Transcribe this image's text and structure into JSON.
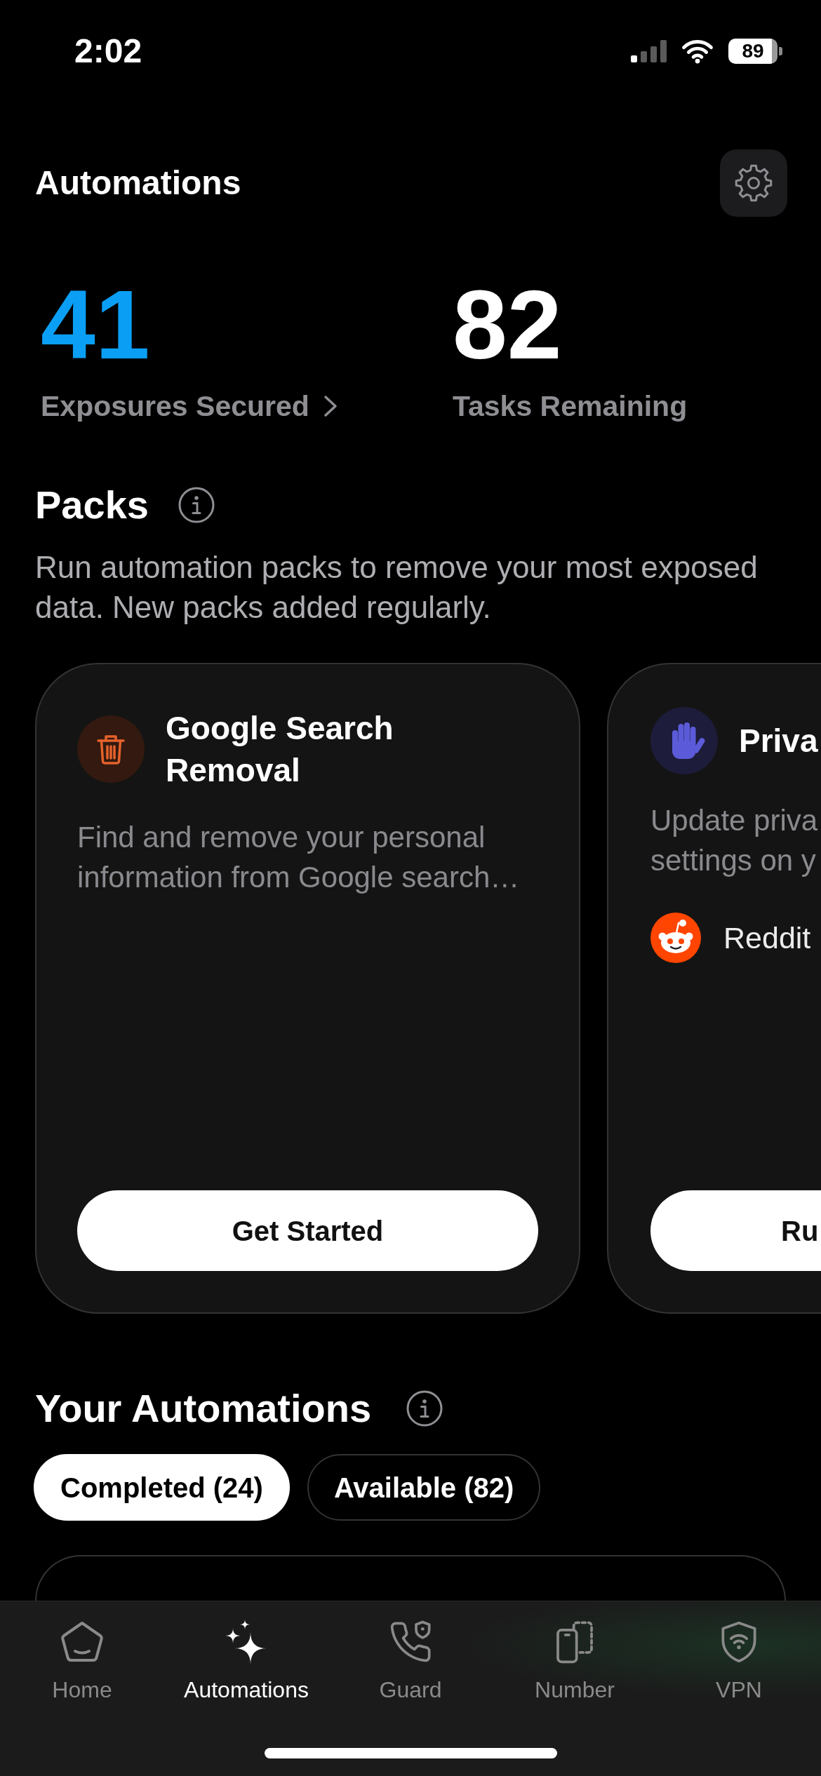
{
  "status_bar": {
    "time": "2:02",
    "battery": "89"
  },
  "header": {
    "title": "Automations"
  },
  "stats": [
    {
      "kind": "link",
      "value": "41",
      "label": "Exposures Secured"
    },
    {
      "kind": "plain",
      "value": "82",
      "label": "Tasks Remaining"
    }
  ],
  "packs": {
    "title": "Packs",
    "description": "Run automation packs to remove your most exposed data. New packs added regularly.",
    "cards": [
      {
        "kind": "removal",
        "title": "Google Search Removal",
        "description": "Find and remove your personal information from Google search…",
        "button": "Get Started"
      },
      {
        "kind": "privacy",
        "title": "Priva",
        "description": "Update priva settings on y",
        "platforms": [
          {
            "name": "Reddit"
          }
        ],
        "button": "Ru"
      }
    ]
  },
  "your_automations": {
    "title": "Your Automations",
    "tabs": [
      {
        "label": "Completed (24)",
        "selected": true
      },
      {
        "label": "Available (82)",
        "selected": false
      }
    ]
  },
  "tab_bar": [
    {
      "label": "Home",
      "selected": false
    },
    {
      "label": "Automations",
      "selected": true
    },
    {
      "label": "Guard",
      "selected": false
    },
    {
      "label": "Number",
      "selected": false
    },
    {
      "label": "VPN",
      "selected": false
    }
  ]
}
